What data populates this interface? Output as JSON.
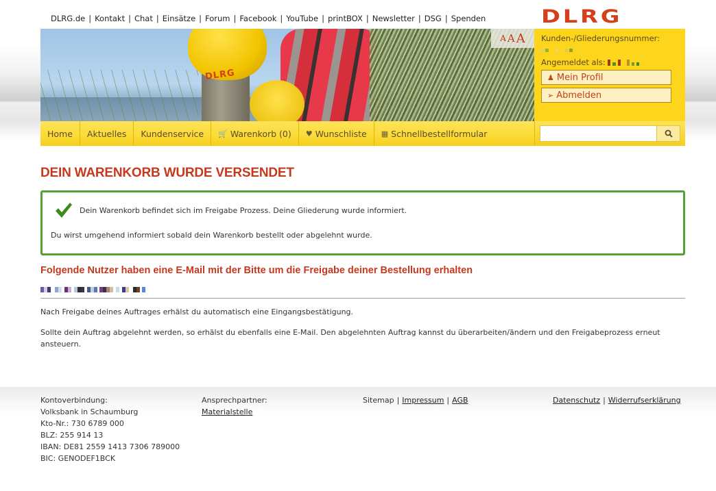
{
  "top_links": [
    "DLRG.de",
    "Kontakt",
    "Chat",
    "Einsätze",
    "Forum",
    "Facebook",
    "YouTube",
    "printBOX",
    "Newsletter",
    "DSG",
    "Spenden"
  ],
  "logo_text": "DLRG",
  "banner": {
    "helmet_text": "DLRG",
    "font_size_controls": [
      "A",
      "A",
      "A"
    ]
  },
  "account": {
    "customer_number_label": "Kunden-/Gliederungsnummer:",
    "customer_number_value": "[redacted]",
    "logged_in_label": "Angemeldet als:",
    "logged_in_value": "[redacted]",
    "profile_button": "Mein Profil",
    "logout_button": "Abmelden"
  },
  "nav": {
    "items": [
      {
        "label": "Home",
        "icon": ""
      },
      {
        "label": "Aktuelles",
        "icon": ""
      },
      {
        "label": "Kundenservice",
        "icon": ""
      },
      {
        "label": "Warenkorb (0)",
        "icon": "cart-icon"
      },
      {
        "label": "Wunschliste",
        "icon": "heart-icon"
      },
      {
        "label": "Schnellbestellformular",
        "icon": "table-icon"
      }
    ],
    "search_placeholder": "",
    "search_value": ""
  },
  "main": {
    "title": "DEIN WARENKORB WURDE VERSENDET",
    "success_line1": "Dein Warenkorb befindet sich im Freigabe Prozess. Deine Gliederung wurde informiert.",
    "success_line2": "Du wirst umgehend informiert sobald dein Warenkorb bestellt oder abgelehnt wurde.",
    "users_heading": "Folgende Nutzer haben eine E-Mail mit der Bitte um die Freigabe deiner Bestellung erhalten",
    "users_value": "[redacted]",
    "paragraph1": "Nach Freigabe deines Auftrages erhälst du automatisch eine Eingangsbestätigung.",
    "paragraph2": "Sollte dein Auftrag abgelehnt werden, so erhälst du ebenfalls eine E-Mail. Den abgelehnten Auftrag kannst du überarbeiten/ändern und den Freigabeprozess erneut ansteuern."
  },
  "colors": {
    "accent": "#c6391e",
    "yellow": "#fdd51c",
    "success": "#55a03a"
  },
  "footer": {
    "bank": {
      "label": "Kontoverbindung:",
      "lines": [
        "Volksbank in Schaumburg",
        "Kto-Nr.: 730 6789 000",
        "BLZ: 255 914 13",
        "IBAN: DE81 2559 1413 7306 789000",
        "BIC: GENODEF1BCK"
      ]
    },
    "contact": {
      "label": "Ansprechpartner:",
      "link": "Materialstelle"
    },
    "middle_links": {
      "sitemap": "Sitemap",
      "impressum": "Impressum",
      "agb": "AGB"
    },
    "right_links": {
      "datenschutz": "Datenschutz",
      "widerruf": "Widerrufserklärung"
    },
    "separator": "|"
  }
}
